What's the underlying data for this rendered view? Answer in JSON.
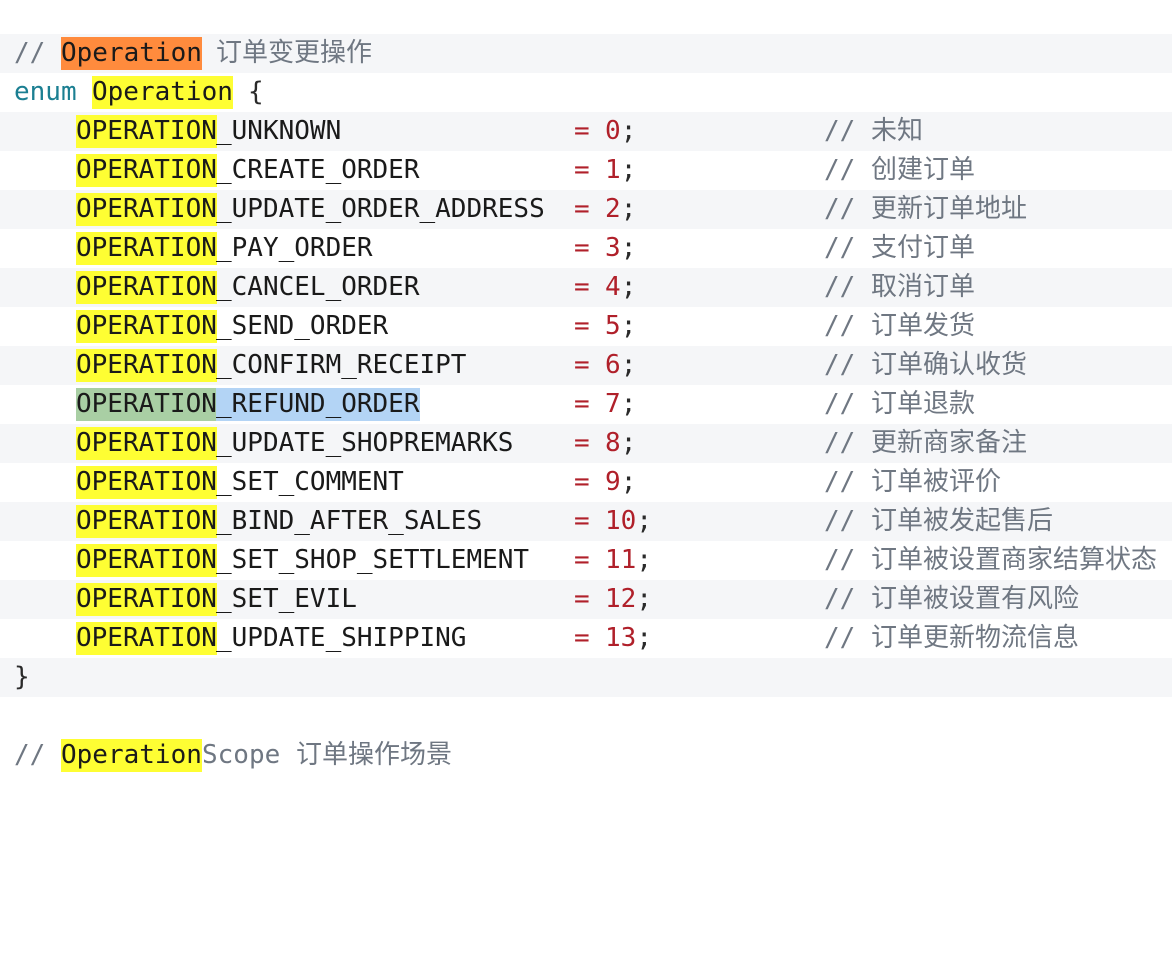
{
  "header_comment": {
    "slashes": "//",
    "name": "Operation",
    "desc": "订单变更操作"
  },
  "enum_decl": {
    "keyword": "enum",
    "name": "Operation",
    "open": "{"
  },
  "entries": [
    {
      "prefix": "OPERATION",
      "suffix": "_UNKNOWN",
      "eq": "=",
      "value": "0",
      "semi": ";",
      "comment": "// 未知"
    },
    {
      "prefix": "OPERATION",
      "suffix": "_CREATE_ORDER",
      "eq": "=",
      "value": "1",
      "semi": ";",
      "comment": "// 创建订单"
    },
    {
      "prefix": "OPERATION",
      "suffix": "_UPDATE_ORDER_ADDRESS",
      "eq": "=",
      "value": "2",
      "semi": ";",
      "comment": "// 更新订单地址"
    },
    {
      "prefix": "OPERATION",
      "suffix": "_PAY_ORDER",
      "eq": "=",
      "value": "3",
      "semi": ";",
      "comment": "// 支付订单"
    },
    {
      "prefix": "OPERATION",
      "suffix": "_CANCEL_ORDER",
      "eq": "=",
      "value": "4",
      "semi": ";",
      "comment": "// 取消订单"
    },
    {
      "prefix": "OPERATION",
      "suffix": "_SEND_ORDER",
      "eq": "=",
      "value": "5",
      "semi": ";",
      "comment": "// 订单发货"
    },
    {
      "prefix": "OPERATION",
      "suffix": "_CONFIRM_RECEIPT",
      "eq": "=",
      "value": "6",
      "semi": ";",
      "comment": "// 订单确认收货"
    },
    {
      "prefix": "OPERATION",
      "suffix": "_REFUND_ORDER",
      "eq": "=",
      "value": "7",
      "semi": ";",
      "comment": "// 订单退款"
    },
    {
      "prefix": "OPERATION",
      "suffix": "_UPDATE_SHOPREMARKS",
      "eq": "=",
      "value": "8",
      "semi": ";",
      "comment": "// 更新商家备注"
    },
    {
      "prefix": "OPERATION",
      "suffix": "_SET_COMMENT",
      "eq": "=",
      "value": "9",
      "semi": ";",
      "comment": "// 订单被评价"
    },
    {
      "prefix": "OPERATION",
      "suffix": "_BIND_AFTER_SALES",
      "eq": "=",
      "value": "10",
      "semi": ";",
      "comment": "// 订单被发起售后"
    },
    {
      "prefix": "OPERATION",
      "suffix": "_SET_SHOP_SETTLEMENT",
      "eq": "=",
      "value": "11",
      "semi": ";",
      "comment": "// 订单被设置商家结算状态"
    },
    {
      "prefix": "OPERATION",
      "suffix": "_SET_EVIL",
      "eq": "=",
      "value": "12",
      "semi": ";",
      "comment": "// 订单被设置有风险"
    },
    {
      "prefix": "OPERATION",
      "suffix": "_UPDATE_SHIPPING",
      "eq": "=",
      "value": "13",
      "semi": ";",
      "comment": "// 订单更新物流信息"
    }
  ],
  "closing": "}",
  "next_comment": {
    "slashes": "//",
    "name": "Operation",
    "name_rest": "Scope",
    "desc": "订单操作场景"
  },
  "colors": {
    "highlight_yellow": "#fefe33",
    "highlight_orange": "#ff8b3d",
    "selection_green": "#a9cfa4",
    "selection_blue": "#b3d4f5",
    "keyword": "#1b7f92",
    "number": "#b0202a",
    "comment": "#6f7782"
  }
}
